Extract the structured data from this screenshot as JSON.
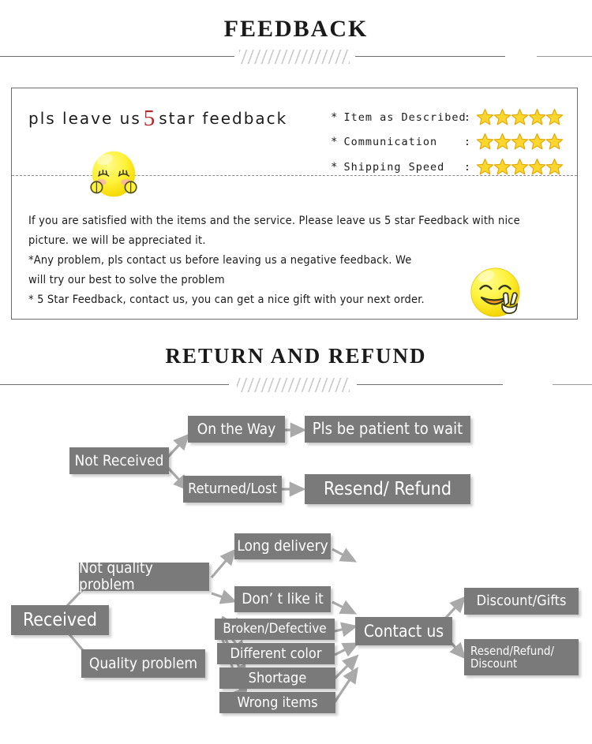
{
  "sections": {
    "feedback_title": "FEEDBACK",
    "return_title": "RETURN AND REFUND"
  },
  "feedback": {
    "headline_prefix": "pls leave us",
    "headline_number": "5",
    "headline_suffix": "star feedback",
    "ratings": [
      {
        "bullet": "*",
        "label": "Item as Described",
        "colon": ":",
        "stars": 5
      },
      {
        "bullet": "*",
        "label": "Communication",
        "colon": ":",
        "stars": 5
      },
      {
        "bullet": "*",
        "label": "Shipping Speed",
        "colon": ":",
        "stars": 5
      }
    ],
    "paragraph": [
      "If you are satisfied with the items and the service. Please leave us 5 star Feedback with nice",
      "picture. we will be appreciated it.",
      "*Any problem, pls contact us before leaving us a negative feedback. We",
      "will try our best to solve  the problem",
      "* 5 Star Feedback, contact us, you can get a nice gift with your next order."
    ],
    "emoji_left": "shy-blushing-face-emoji",
    "emoji_right": "smiling-face-with-peace-sign-emoji"
  },
  "flowchart": {
    "nodes": {
      "not_received": "Not Received",
      "on_the_way": "On the Way",
      "pls_be_patient": "Pls be patient to wait",
      "returned_lost": "Returned/Lost",
      "resend_refund": "Resend/ Refund",
      "received": "Received",
      "not_quality_problem": "Not quality problem",
      "quality_problem": "Quality problem",
      "long_delivery": "Long delivery",
      "dont_like_it": "Don’ t like it",
      "broken_defective": "Broken/Defective",
      "different_color": "Different color",
      "shortage": "Shortage",
      "wrong_items": "Wrong items",
      "contact_us": "Contact us",
      "discount_gifts": "Discount/Gifts",
      "resend_refund_discount_l1": "Resend/Refund/",
      "resend_refund_discount_l2": "Discount"
    }
  },
  "colors": {
    "node_fill": "#7a7a7a",
    "node_text": "#ffffff",
    "star": "#FFD62E",
    "star_stroke": "#E0A800",
    "accent_red": "#b7252b",
    "rule": "#6e6e72",
    "border": "#6d6d71"
  }
}
